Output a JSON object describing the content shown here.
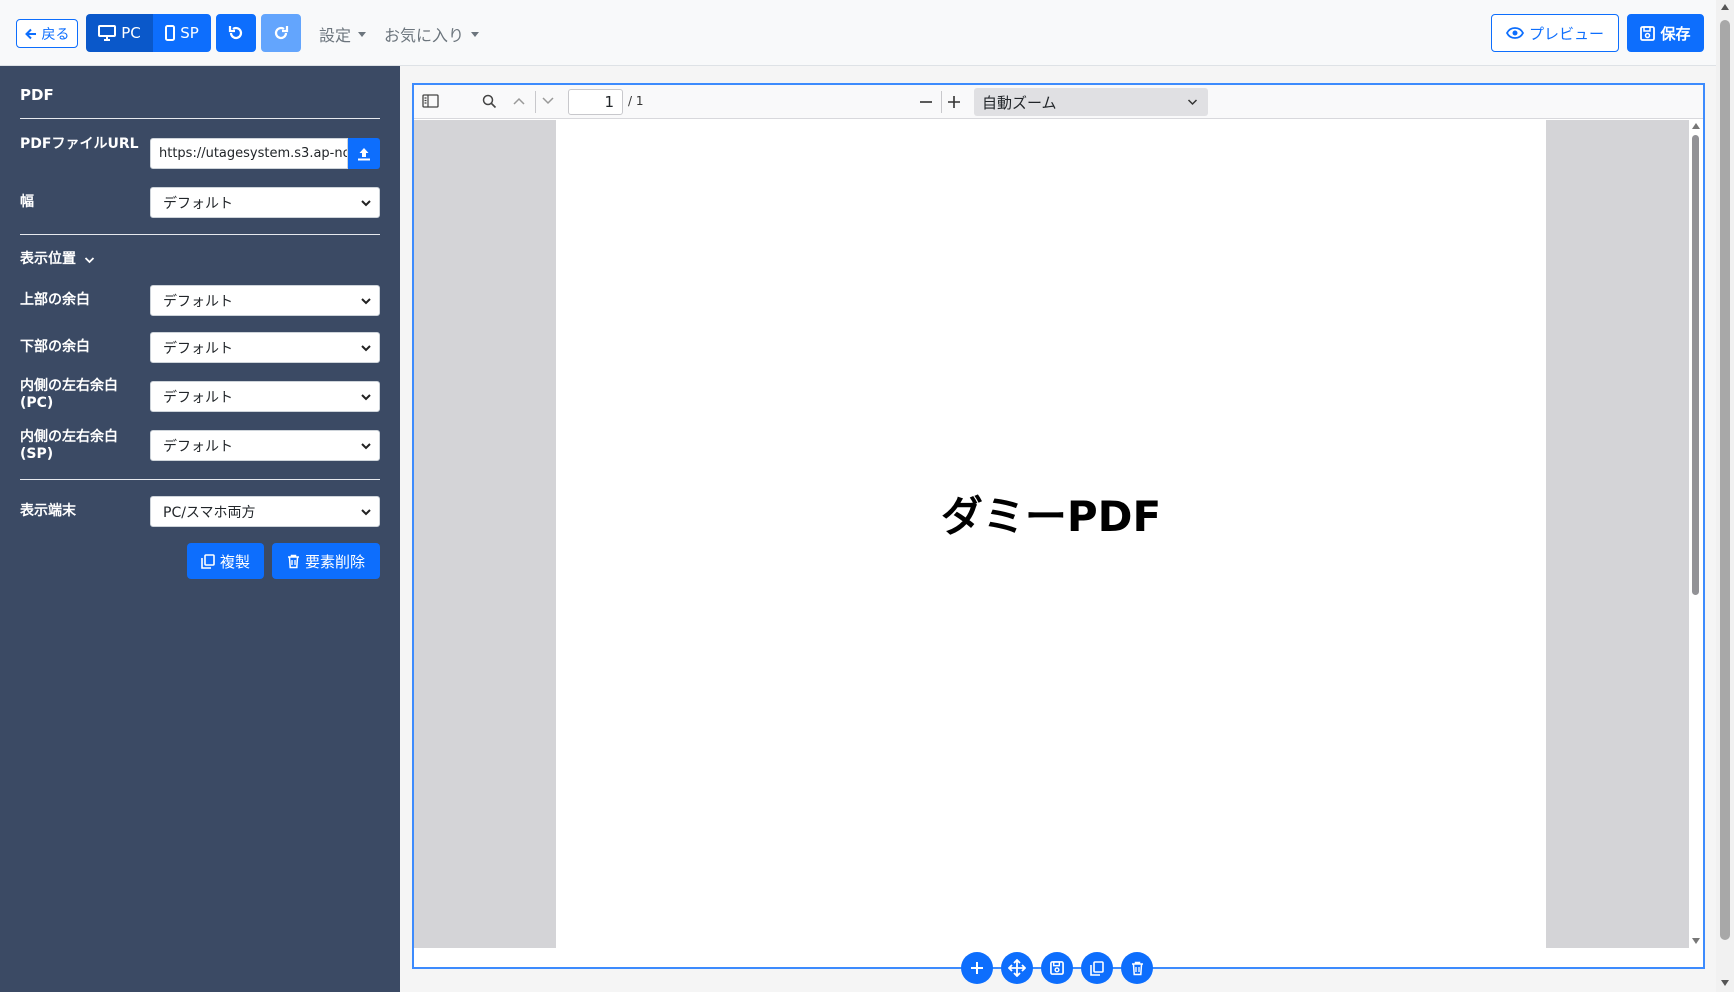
{
  "toolbar": {
    "back_label": "戻る",
    "pc_label": "PC",
    "sp_label": "SP",
    "settings_label": "設定",
    "favorites_label": "お気に入り",
    "preview_label": "プレビュー",
    "save_label": "保存"
  },
  "sidebar": {
    "title": "PDF",
    "pdf_url_label": "PDFファイルURL",
    "pdf_url_value": "https://utagesystem.s3.ap-no",
    "width_label": "幅",
    "width_value": "デフォルト",
    "position_section_label": "表示位置",
    "top_margin_label": "上部の余白",
    "top_margin_value": "デフォルト",
    "bottom_margin_label": "下部の余白",
    "bottom_margin_value": "デフォルト",
    "inner_padding_pc_label": "内側の左右余白(PC)",
    "inner_padding_pc_value": "デフォルト",
    "inner_padding_sp_label": "内側の左右余白(SP)",
    "inner_padding_sp_value": "デフォルト",
    "device_label": "表示端末",
    "device_value": "PC/スマホ両方",
    "duplicate_label": "複製",
    "delete_label": "要素削除"
  },
  "viewer": {
    "page_number": "1",
    "page_total": "/ 1",
    "zoom_value": "自動ズーム",
    "document_text": "ダミーPDF"
  },
  "colors": {
    "primary": "#0d6efd",
    "sidebar_bg": "#3b4a64",
    "viewer_bg": "#d4d4d7"
  }
}
